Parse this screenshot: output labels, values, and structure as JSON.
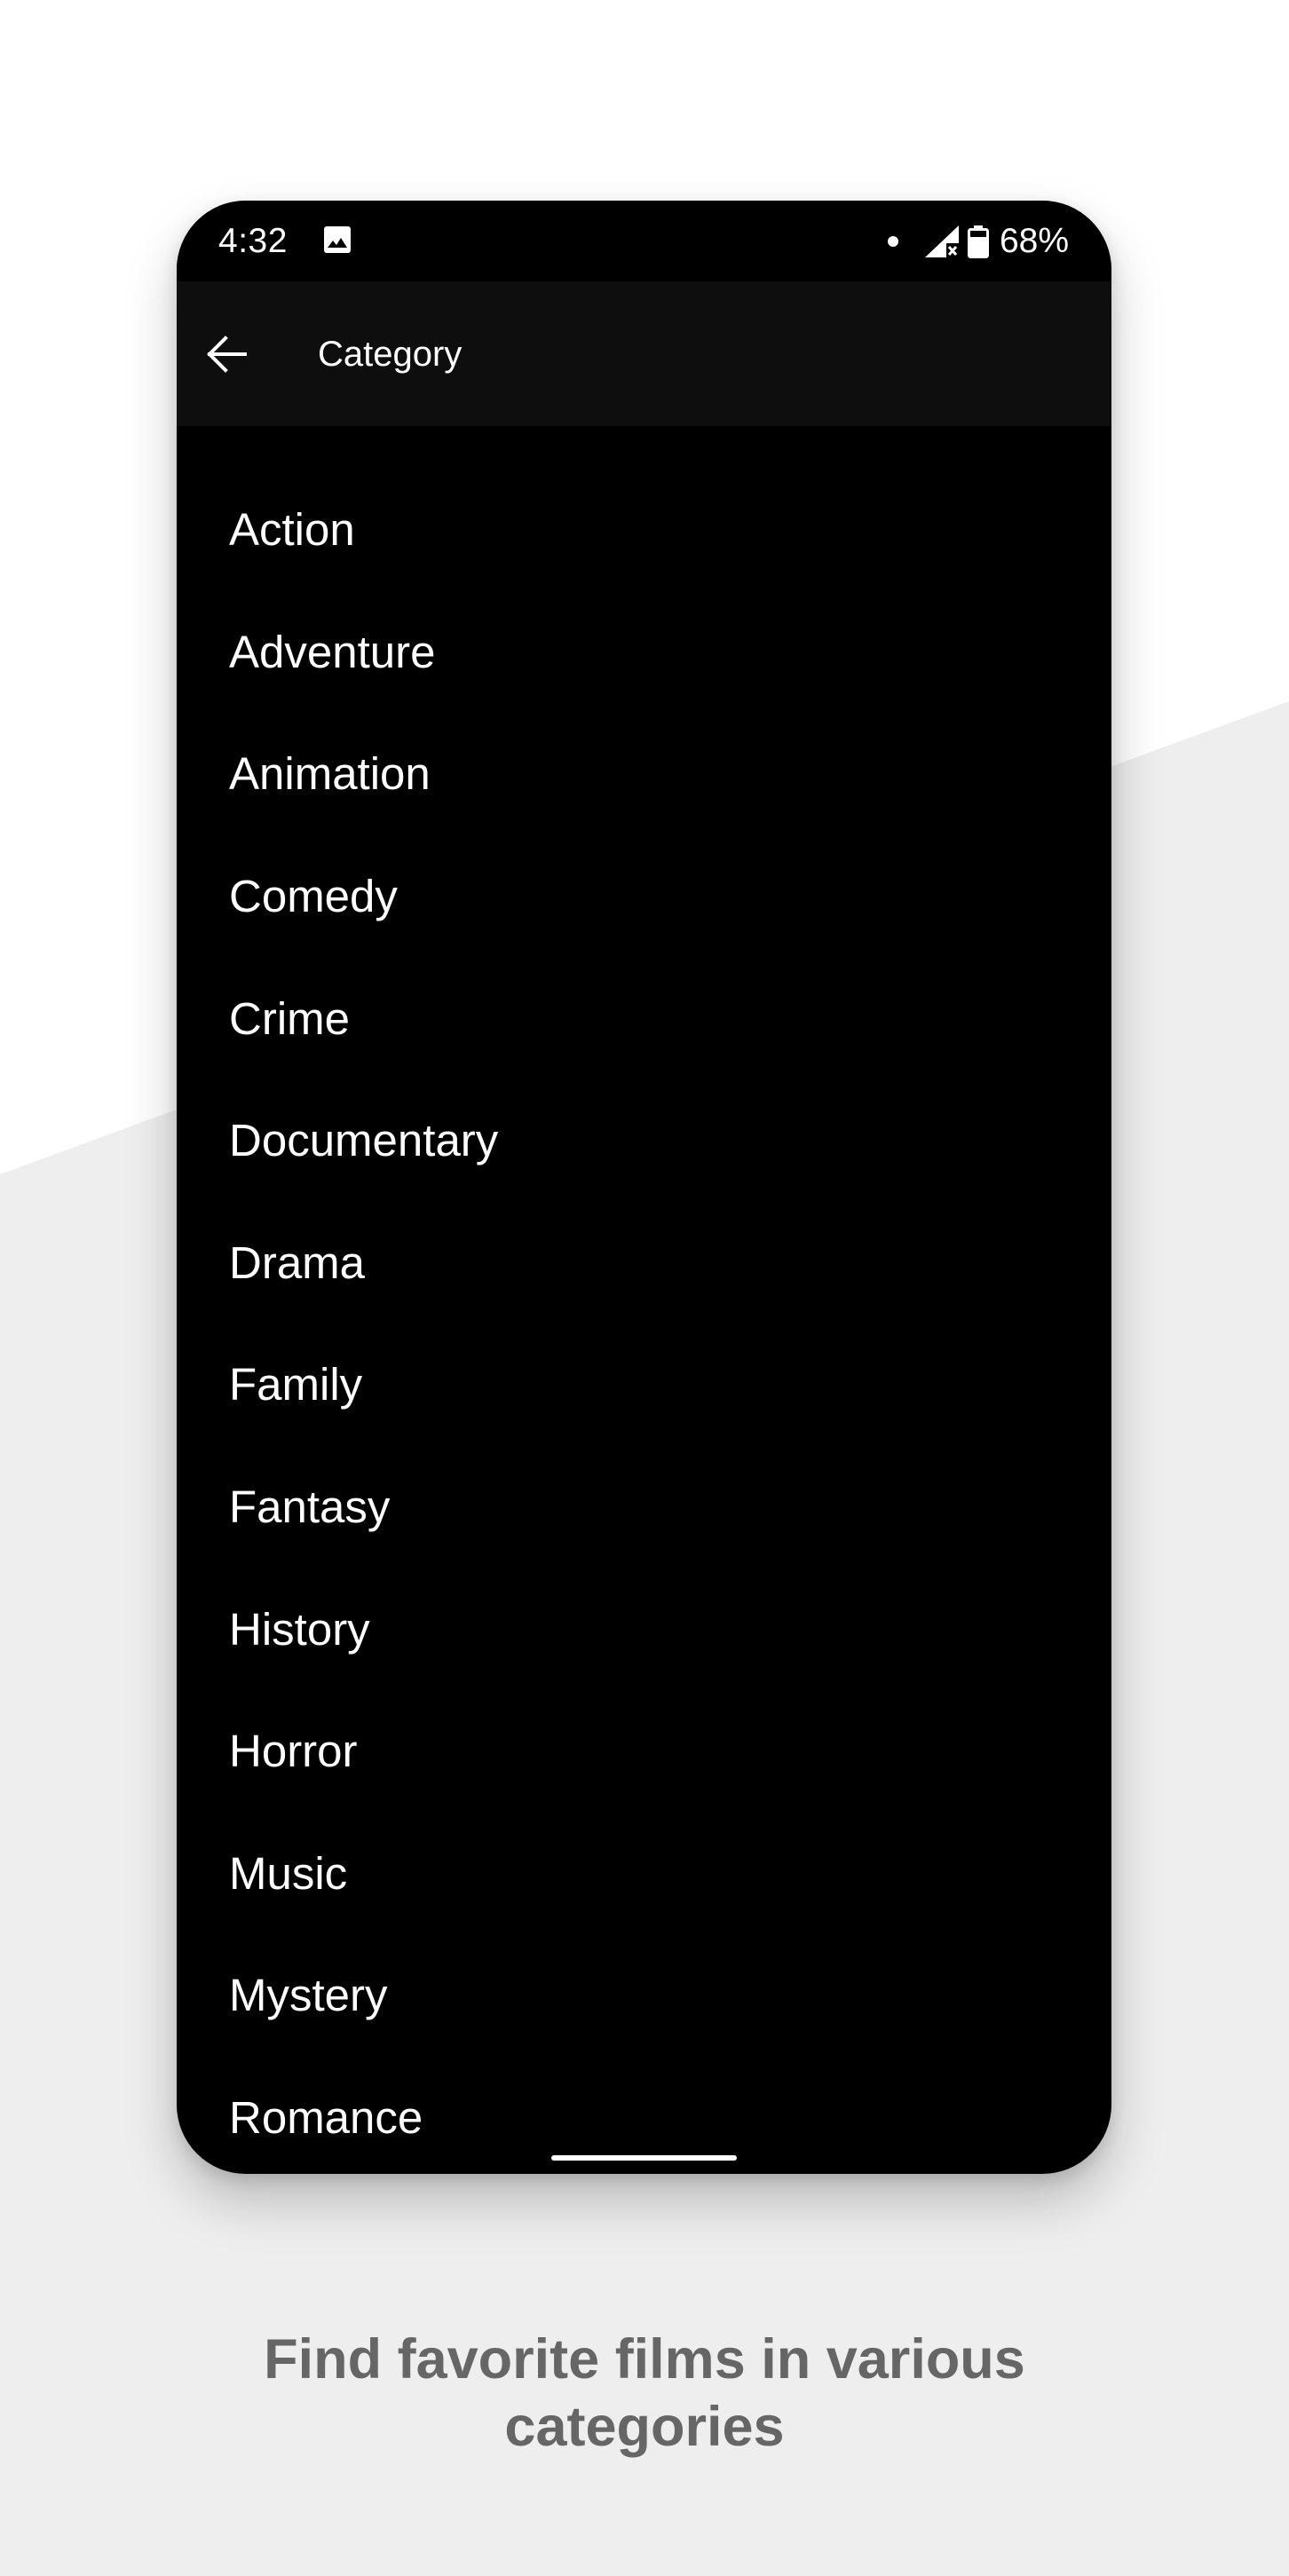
{
  "colors": {
    "page_top_bg": "#ffffff",
    "page_band_bg": "#eeeeee",
    "phone_bg": "#000000",
    "app_bar_bg": "#0e0e0e",
    "text_primary": "#ffffff",
    "caption_text": "#666666"
  },
  "status_bar": {
    "time": "4:32",
    "left_icons": [
      "image-icon"
    ],
    "right_icons": [
      "notification-dot-icon",
      "signal-no-data-icon",
      "battery-icon"
    ],
    "battery_percent": "68%"
  },
  "app_bar": {
    "back_icon": "arrow-left-icon",
    "title": "Category"
  },
  "categories": [
    {
      "label": "Action"
    },
    {
      "label": "Adventure"
    },
    {
      "label": "Animation"
    },
    {
      "label": "Comedy"
    },
    {
      "label": "Crime"
    },
    {
      "label": "Documentary"
    },
    {
      "label": "Drama"
    },
    {
      "label": "Family"
    },
    {
      "label": "Fantasy"
    },
    {
      "label": "History"
    },
    {
      "label": "Horror"
    },
    {
      "label": "Music"
    },
    {
      "label": "Mystery"
    },
    {
      "label": "Romance"
    }
  ],
  "caption": {
    "line1": "Find favorite films in various",
    "line2": "categories"
  }
}
